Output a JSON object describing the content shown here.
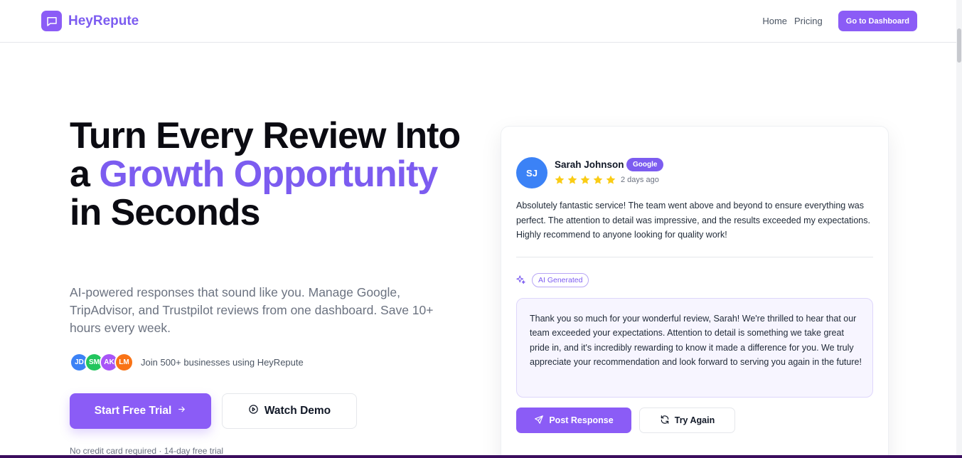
{
  "header": {
    "brand": "HeyRepute",
    "nav": [
      {
        "label": "Home"
      },
      {
        "label": "Pricing"
      }
    ],
    "cta_label": "Go to Dashboard"
  },
  "hero": {
    "title_parts": [
      "Turn Every Review Into a ",
      "Growth Opportunity",
      " in Seconds"
    ],
    "subtitle": "AI-powered responses that sound like you. Manage Google, TripAdvisor, and Trustpilot reviews from one dashboard. Save 10+ hours every week.",
    "avatars": [
      {
        "initials": "JD",
        "color": "#3b82f6"
      },
      {
        "initials": "SM",
        "color": "#22c55e"
      },
      {
        "initials": "AK",
        "color": "#a855f7"
      },
      {
        "initials": "LM",
        "color": "#f97316"
      }
    ],
    "social_proof": "Join 500+ businesses using HeyRepute",
    "primary_label": "Start Free Trial",
    "secondary_label": "Watch Demo",
    "fineprint": "No credit card required · 14-day free trial"
  },
  "review": {
    "initials": "SJ",
    "name": "Sarah Johnson",
    "source": "Google",
    "rating": 5,
    "time": "2 days ago",
    "text": "Absolutely fantastic service! The team went above and beyond to ensure everything was perfect. The attention to detail was impressive, and the results exceeded my expectations. Highly recommend to anyone looking for quality work!",
    "ai_badge": "AI Generated",
    "response": "Thank you so much for your wonderful review, Sarah! We're thrilled to hear that our team exceeded your expectations. Attention to detail is something we take great pride in, and it's incredibly rewarding to know it made a difference for you. We truly appreciate your recommendation and look forward to serving you again in the future!",
    "post_label": "Post Response",
    "retry_label": "Try Again"
  },
  "colors": {
    "accent": "#8b5cf6",
    "star": "#facc15"
  },
  "icons": [
    "chat-bubble-icon",
    "arrow-right-icon",
    "play-circle-icon",
    "star-icon",
    "sparkles-icon",
    "send-icon",
    "refresh-icon"
  ]
}
